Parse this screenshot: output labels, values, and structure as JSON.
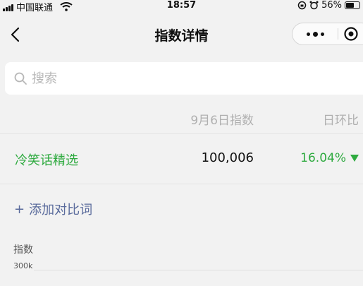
{
  "status_bar": {
    "carrier": "中国联通",
    "time": "18:57",
    "battery": "56%"
  },
  "nav": {
    "title": "指数详情"
  },
  "search": {
    "placeholder": "搜索"
  },
  "table": {
    "date_header": "9月6日指数",
    "change_header": "日环比",
    "rows": [
      {
        "name": "冷笑话精选",
        "value": "100,006",
        "change": "16.04%",
        "direction": "down"
      }
    ]
  },
  "compare": {
    "label": "添加对比词"
  },
  "chart": {
    "ylabel": "指数",
    "tick_top": "300k"
  },
  "colors": {
    "accent_green": "#2eaa3f",
    "link_blue": "#5a6b9c",
    "background": "#f2f2f2"
  }
}
